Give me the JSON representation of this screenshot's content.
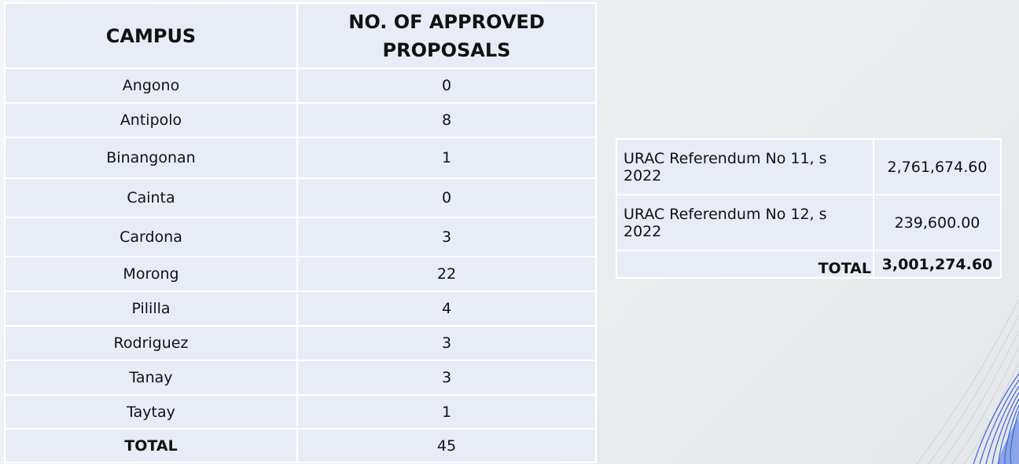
{
  "campus_table": {
    "headers": {
      "campus": "CAMPUS",
      "count_line1": "NO. OF APPROVED",
      "count_line2": "PROPOSALS"
    },
    "rows": [
      {
        "campus": "Angono",
        "count": "0"
      },
      {
        "campus": "Antipolo",
        "count": "8"
      },
      {
        "campus": "Binangonan",
        "count": "1"
      },
      {
        "campus": "Cainta",
        "count": "0"
      },
      {
        "campus": "Cardona",
        "count": "3"
      },
      {
        "campus": "Morong",
        "count": "22"
      },
      {
        "campus": "Pililla",
        "count": "4"
      },
      {
        "campus": "Rodriguez",
        "count": "3"
      },
      {
        "campus": "Tanay",
        "count": "3"
      },
      {
        "campus": "Taytay",
        "count": "1"
      }
    ],
    "total": {
      "label": "TOTAL",
      "count": "45"
    }
  },
  "funds_table": {
    "rows": [
      {
        "label": "URAC Referendum No 11, s 2022",
        "amount": "2,761,674.60"
      },
      {
        "label": "URAC Referendum No 12, s 2022",
        "amount": "239,600.00"
      }
    ],
    "total": {
      "label": "TOTAL",
      "amount": "3,001,274.60"
    }
  },
  "colors": {
    "cell_background": "#e8ecf6",
    "cell_border": "#ffffff",
    "decoration_blue": "#3b63d9"
  }
}
